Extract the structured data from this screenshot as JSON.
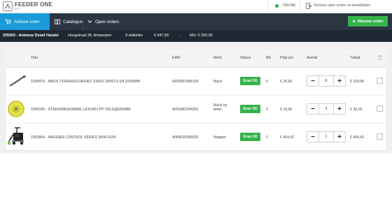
{
  "app": {
    "brand": "FEEDER ONE",
    "brand_sub": "APP",
    "status": "ONLINE",
    "send_action": "Verstuur open orders en bestellijsten"
  },
  "nav": {
    "tabs": [
      {
        "label": "Actieve order",
        "icon": "cart-icon",
        "active": true
      },
      {
        "label": "Catalogus",
        "icon": "book-icon",
        "active": false
      },
      {
        "label": "Open orders",
        "icon": "chevron-down-icon",
        "active": false
      }
    ],
    "new_order": "Nieuwe order"
  },
  "order_info": {
    "order_id": "205003 - Antwerp Detail Handel",
    "address": "Hoogstraat 36, Antwerpen",
    "articles": "9 artikelen",
    "total": "€ 647,56",
    "separator": "-",
    "minimum": "Min: € 250,00"
  },
  "table": {
    "columns": [
      "Titel",
      "EAN",
      "Merk",
      "Status",
      "BE",
      "Prijs p/s",
      "Aantal",
      "Totaal"
    ],
    "rows": [
      {
        "thumb": "screw-image",
        "title": "1004975 - MACK TERRASSCHROEF SS410 200ST.5,0/4,0X60MM",
        "ean": "5400997686105",
        "merk": "Mack",
        "status": "Scan OK",
        "be": "6",
        "price": "€ 25,66",
        "qty": "6",
        "total": "€ 153,96"
      },
      {
        "thumb": "wheel-image",
        "title": "1006185 - STEEKWAGENWIEL LEKVRIJ PP VELG@260MM",
        "ean": "4031582204261",
        "merk": "Mack by tente",
        "status": "Scan OK",
        "be": "2",
        "price": "€ 19,59",
        "qty": "2",
        "total": "€ 39,18"
      },
      {
        "thumb": "sprayer-image",
        "title": "1053964 - WAGNER CONTROL SERIES 350R EUR",
        "ean": "4004025086632",
        "merk": "Wagner",
        "status": "Scan OK",
        "be": "1",
        "price": "€ 454,42",
        "qty": "1",
        "total": "€ 454,42"
      }
    ]
  },
  "colors": {
    "accent": "#1a9bd7",
    "nav_bg": "#2c3542",
    "info_bg": "#1f2732",
    "success": "#36b34a"
  }
}
